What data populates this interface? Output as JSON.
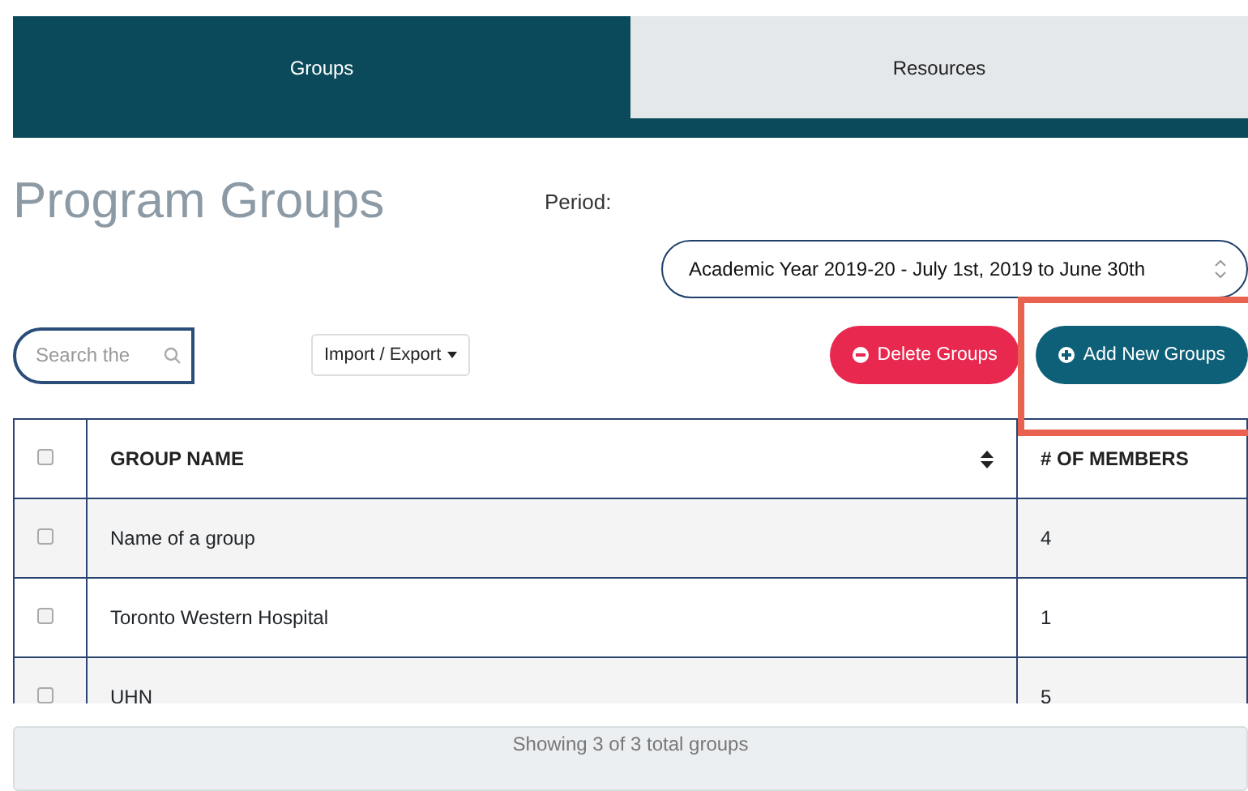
{
  "tabs": [
    {
      "label": "Groups",
      "selected": true
    },
    {
      "label": "Resources",
      "selected": false
    }
  ],
  "title": "Program Groups",
  "period": {
    "label": "Period:",
    "value": "Academic Year 2019-20 - July 1st, 2019 to June 30th"
  },
  "search": {
    "placeholder": "Search the"
  },
  "import_export": "Import / Export",
  "buttons": [
    {
      "kind": "delete",
      "label": "Delete Groups"
    },
    {
      "kind": "add",
      "label": "Add New Groups",
      "highlighted": true
    }
  ],
  "table": {
    "select_all": {
      "checked": false
    },
    "columns": [
      "GROUP NAME",
      "# OF MEMBERS"
    ],
    "rows": [
      {
        "name": "Name of a group",
        "members": "4",
        "checked": false
      },
      {
        "name": "Toronto Western Hospital",
        "members": "1",
        "checked": false
      },
      {
        "name": "UHN",
        "members": "5",
        "checked": false
      }
    ]
  },
  "footer": "Showing 3 of 3 total groups"
}
